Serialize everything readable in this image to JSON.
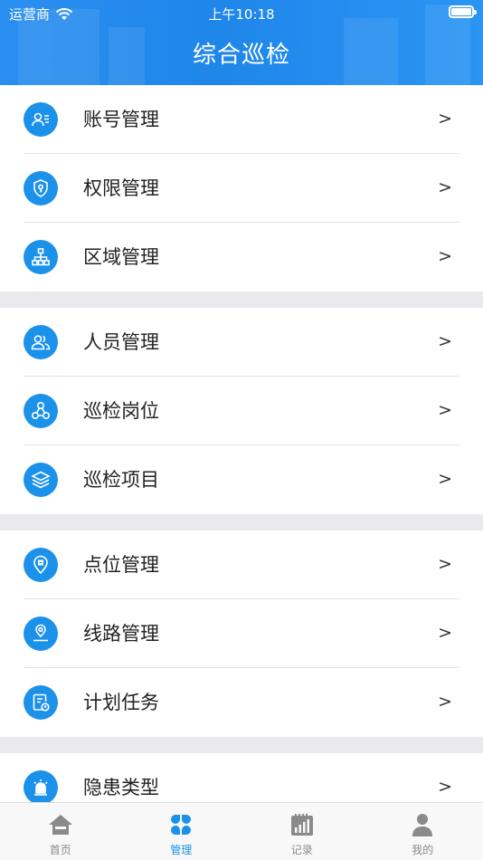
{
  "status_bar": {
    "carrier": "运营商",
    "time": "上午10:18"
  },
  "header": {
    "title": "综合巡检"
  },
  "groups": [
    {
      "items": [
        {
          "label": "账号管理",
          "icon": "account-card-icon",
          "arrow": ">"
        },
        {
          "label": "权限管理",
          "icon": "shield-key-icon",
          "arrow": ">"
        },
        {
          "label": "区域管理",
          "icon": "org-tree-icon",
          "arrow": ">"
        }
      ]
    },
    {
      "items": [
        {
          "label": "人员管理",
          "icon": "people-icon",
          "arrow": ">"
        },
        {
          "label": "巡检岗位",
          "icon": "hierarchy-nodes-icon",
          "arrow": ">"
        },
        {
          "label": "巡检项目",
          "icon": "layers-icon",
          "arrow": ">"
        }
      ]
    },
    {
      "items": [
        {
          "label": "点位管理",
          "icon": "location-pin-icon",
          "arrow": ">"
        },
        {
          "label": "线路管理",
          "icon": "route-icon",
          "arrow": ">"
        },
        {
          "label": "计划任务",
          "icon": "task-clock-icon",
          "arrow": ">"
        }
      ]
    },
    {
      "items": [
        {
          "label": "隐患类型",
          "icon": "alarm-light-icon",
          "arrow": ">"
        }
      ]
    }
  ],
  "tabbar": {
    "tabs": [
      {
        "label": "首页",
        "icon": "home-icon",
        "active": false
      },
      {
        "label": "管理",
        "icon": "grid-petals-icon",
        "active": true
      },
      {
        "label": "记录",
        "icon": "chart-record-icon",
        "active": false
      },
      {
        "label": "我的",
        "icon": "user-icon",
        "active": false
      }
    ]
  },
  "colors": {
    "accent": "#1C91EA",
    "header": "#2A8FF0",
    "background": "#E9E9EE",
    "tab_inactive": "#8A8A8A"
  }
}
